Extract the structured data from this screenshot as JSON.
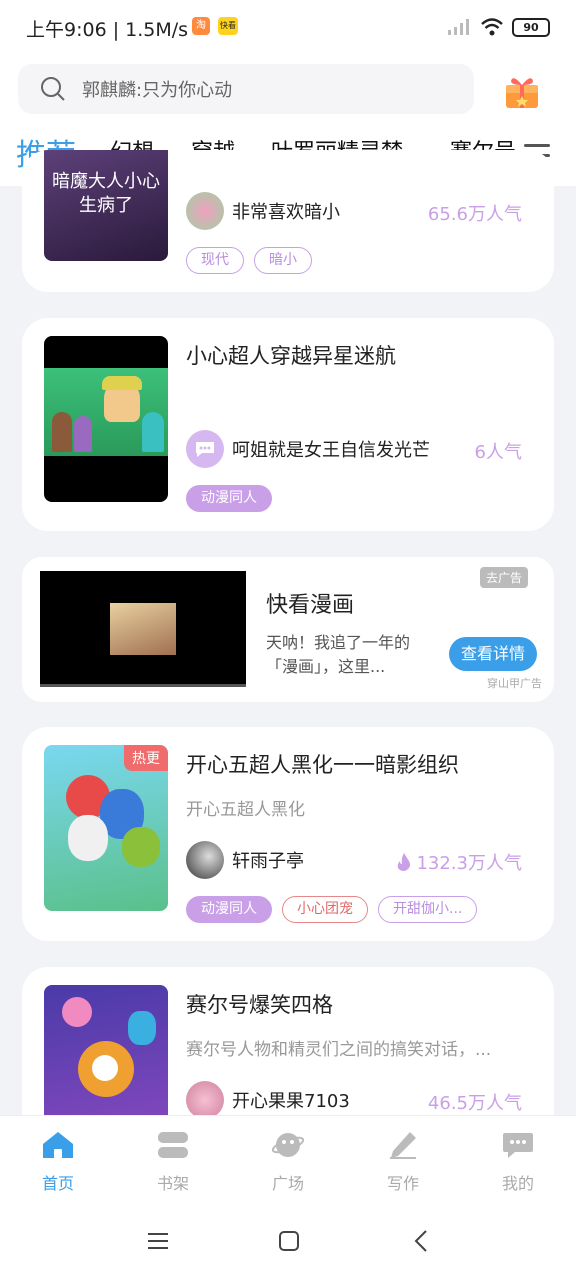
{
  "status_bar": {
    "time": "上午9:06 | 1.5M/s",
    "app1": "淘",
    "app2": "快看",
    "battery": "90"
  },
  "search": {
    "placeholder": "郭麒麟:只为你心动"
  },
  "tabs": [
    "推荐",
    "幻想",
    "穿越",
    "叶罗丽精灵梦",
    "赛尔号"
  ],
  "cards": [
    {
      "cover_text": "暗魔大人小心生病了",
      "author": "非常喜欢暗小",
      "popularity": "65.6万人气",
      "tags": [
        "现代",
        "暗小"
      ]
    },
    {
      "title": "小心超人穿越异星迷航",
      "author": "呵姐就是女王自信发光芒",
      "popularity": "6人气",
      "tags": [
        "动漫同人"
      ]
    },
    {
      "title": "开心五超人黑化一一暗影组织",
      "subtitle": "开心五超人黑化",
      "author": "轩雨子亭",
      "popularity": "132.3万人气",
      "badge": "热更",
      "tags": [
        "动漫同人",
        "小心团宠",
        "开甜伽小..."
      ]
    },
    {
      "title": "赛尔号爆笑四格",
      "subtitle": "赛尔号人物和精灵们之间的搞笑对话，...",
      "author": "开心果果7103",
      "popularity": "46.5万人气"
    }
  ],
  "ad": {
    "title": "快看漫画",
    "desc": "天呐！我追了一年的「漫画」，这里...",
    "button": "查看详情",
    "remove": "去广告",
    "source": "穿山甲广告"
  },
  "bottom_nav": [
    "首页",
    "书架",
    "广场",
    "写作",
    "我的"
  ],
  "colors": {
    "accent": "#3a9fe8",
    "tag_purple": "#c9a0e8",
    "hot": "#f06b6b"
  }
}
